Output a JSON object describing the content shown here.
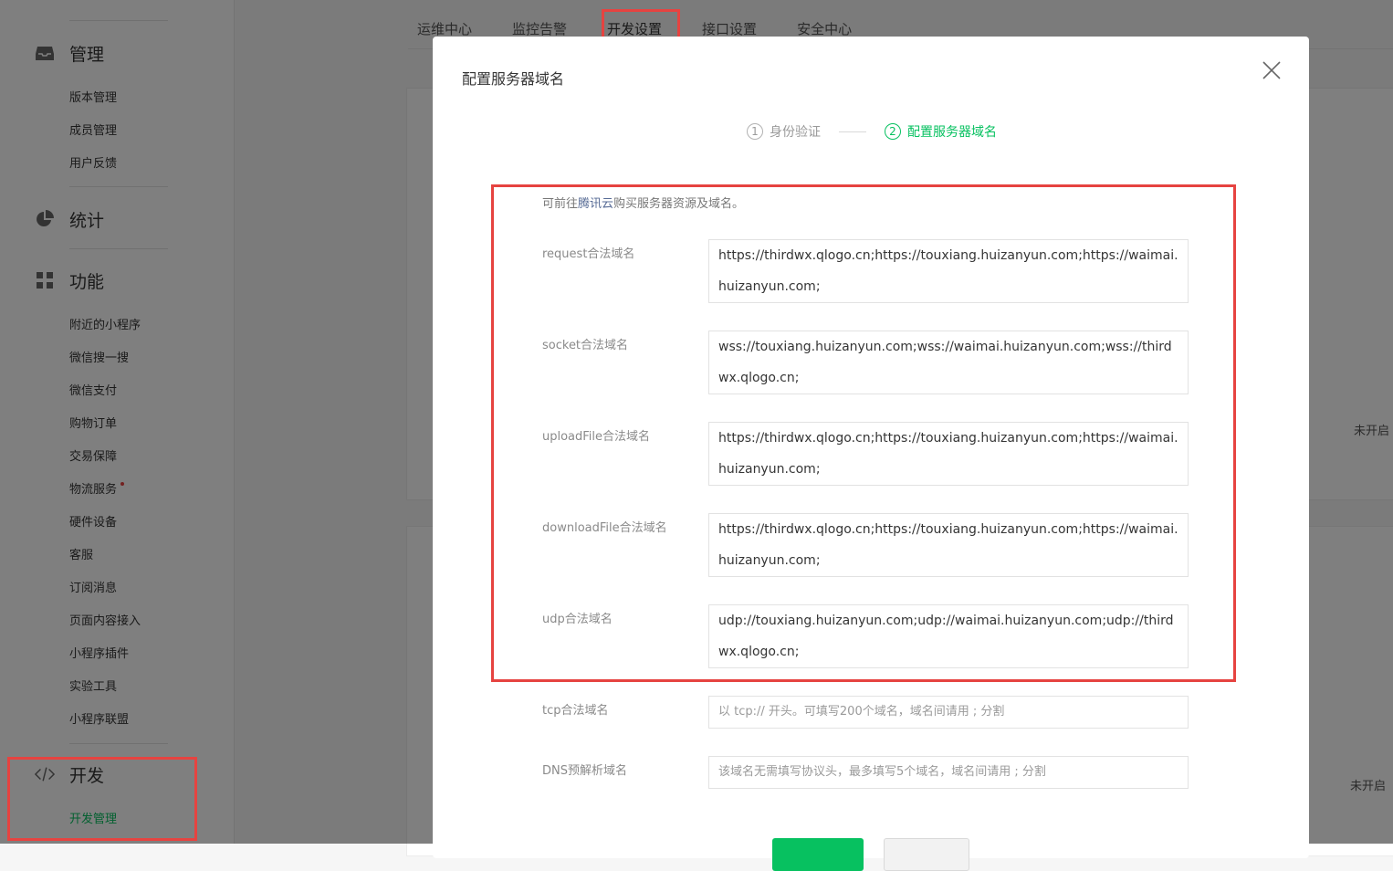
{
  "sidebar": {
    "groups": [
      {
        "label": "管理",
        "icon": "inbox-icon",
        "items": [
          "版本管理",
          "成员管理",
          "用户反馈"
        ]
      },
      {
        "label": "统计",
        "icon": "pie-chart-icon",
        "items": []
      },
      {
        "label": "功能",
        "icon": "grid-icon",
        "items": [
          "附近的小程序",
          "微信搜一搜",
          "微信支付",
          "购物订单",
          "交易保障",
          "物流服务",
          "硬件设备",
          "客服",
          "订阅消息",
          "页面内容接入",
          "小程序插件",
          "实验工具",
          "小程序联盟"
        ]
      },
      {
        "label": "开发",
        "icon": "code-icon",
        "items": [
          "开发管理"
        ]
      }
    ]
  },
  "tabs": [
    "运维中心",
    "监控告警",
    "开发设置",
    "接口设置",
    "安全中心"
  ],
  "right_notes": [
    "未开启",
    "未开启"
  ],
  "dialog": {
    "title": "配置服务器域名",
    "steps": [
      {
        "num": "1",
        "label": "身份验证",
        "active": false
      },
      {
        "num": "2",
        "label": "配置服务器域名",
        "active": true
      }
    ],
    "tip_prefix": "可前往",
    "tip_link": "腾讯云",
    "tip_suffix": "购买服务器资源及域名。",
    "fields": [
      {
        "label": "request合法域名",
        "value": "https://thirdwx.qlogo.cn;https://touxiang.huizanyun.com;https://waimai.huizanyun.com;"
      },
      {
        "label": "socket合法域名",
        "value": "wss://touxiang.huizanyun.com;wss://waimai.huizanyun.com;wss://thirdwx.qlogo.cn;"
      },
      {
        "label": "uploadFile合法域名",
        "value": "https://thirdwx.qlogo.cn;https://touxiang.huizanyun.com;https://waimai.huizanyun.com;"
      },
      {
        "label": "downloadFile合法域名",
        "value": "https://thirdwx.qlogo.cn;https://touxiang.huizanyun.com;https://waimai.huizanyun.com;"
      },
      {
        "label": "udp合法域名",
        "value": "udp://touxiang.huizanyun.com;udp://waimai.huizanyun.com;udp://thirdwx.qlogo.cn;"
      }
    ],
    "tcp_label": "tcp合法域名",
    "tcp_placeholder": "以 tcp:// 开头。可填写200个域名，域名间请用 ; 分割",
    "dns_label": "DNS预解析域名",
    "dns_placeholder": "该域名无需填写协议头，最多填写5个域名，域名间请用 ; 分割"
  },
  "colors": {
    "accent": "#07c160",
    "highlight": "#e64340",
    "link": "#576b95"
  }
}
